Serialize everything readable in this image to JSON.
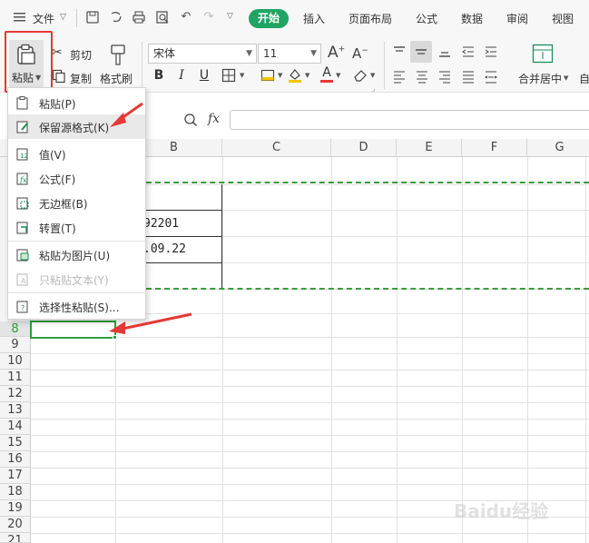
{
  "menubar": {
    "file_label": "文件",
    "tabs": [
      {
        "label": "开始"
      },
      {
        "label": "插入"
      },
      {
        "label": "页面布局"
      },
      {
        "label": "公式"
      },
      {
        "label": "数据"
      },
      {
        "label": "审阅"
      },
      {
        "label": "视图"
      }
    ]
  },
  "ribbon": {
    "paste_label": "粘贴",
    "cut_label": "剪切",
    "copy_label": "复制",
    "format_painter_label": "格式刷",
    "font_name": "宋体",
    "font_size": "11",
    "merge_center_label": "合并居中",
    "auto_label": "自"
  },
  "formula": {
    "fx_label": "fx",
    "value": ""
  },
  "grid": {
    "columns": [
      "B",
      "C",
      "D",
      "E",
      "F",
      "G"
    ],
    "rows": [
      "8",
      "9",
      "10",
      "11",
      "12",
      "13",
      "14",
      "15",
      "16",
      "17",
      "18",
      "19",
      "20",
      "21"
    ],
    "cells": {
      "b3": "92201",
      "b4": ".09.22"
    }
  },
  "paste_menu": {
    "items": [
      {
        "label": "粘贴(P)",
        "enabled": true
      },
      {
        "label": "保留源格式(K)",
        "enabled": true
      },
      {
        "label": "值(V)",
        "enabled": true
      },
      {
        "label": "公式(F)",
        "enabled": true
      },
      {
        "label": "无边框(B)",
        "enabled": true
      },
      {
        "label": "转置(T)",
        "enabled": true
      },
      {
        "label": "粘贴为图片(U)",
        "enabled": true
      },
      {
        "label": "只粘贴文本(Y)",
        "enabled": false
      },
      {
        "label": "选择性粘贴(S)...",
        "enabled": true
      }
    ]
  },
  "colors": {
    "accent_green": "#1fa463",
    "highlight_red": "#e53935",
    "selection_green": "#2e9e3e",
    "marquee_green": "#3a9a3a"
  },
  "watermark": {
    "text": "Baidu经验"
  }
}
